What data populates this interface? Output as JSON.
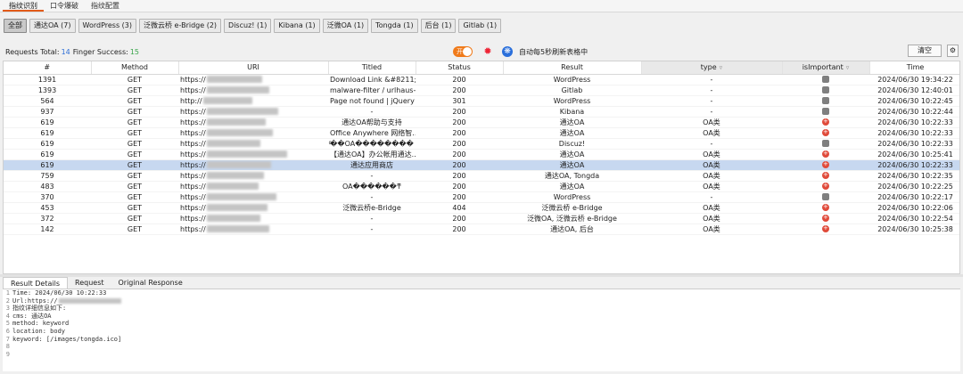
{
  "top_tabs": [
    "指纹识别",
    "口令爆破",
    "指纹配置"
  ],
  "filters": [
    {
      "label": "全部",
      "active": true
    },
    {
      "label": "通达OA (7)"
    },
    {
      "label": "WordPress (3)"
    },
    {
      "label": "泛微云桥 e-Bridge (2)"
    },
    {
      "label": "Discuz! (1)"
    },
    {
      "label": "Kibana (1)"
    },
    {
      "label": "泛微OA (1)"
    },
    {
      "label": "Tongda (1)"
    },
    {
      "label": "后台 (1)"
    },
    {
      "label": "Gitlab (1)"
    }
  ],
  "stats": {
    "requests_label": "Requests Total:",
    "requests_total": "14",
    "finger_label": "Finger Success:",
    "finger_success": "15",
    "toggle_text": "开",
    "auto_refresh_label": "自动每5秒刷新表格中",
    "clear_label": "清空"
  },
  "table": {
    "headers": [
      "#",
      "Method",
      "URI",
      "Titled",
      "Status",
      "Result",
      "type",
      "isImportant",
      "Time"
    ],
    "rows": [
      {
        "id": "1391",
        "method": "GET",
        "uri": "https://",
        "title": "Download Link &#8211; ...",
        "status": "200",
        "result": "WordPress",
        "type": "-",
        "important": "gray",
        "time": "2024/06/30 19:34:22"
      },
      {
        "id": "1393",
        "method": "GET",
        "uri": "https://",
        "title": "malware-filter / urlhaus-fi...",
        "status": "200",
        "result": "Gitlab",
        "type": "-",
        "important": "gray",
        "time": "2024/06/30 12:40:01"
      },
      {
        "id": "564",
        "method": "GET",
        "uri": "http://",
        "title": "Page not found | jQuery F...",
        "status": "301",
        "result": "WordPress",
        "type": "-",
        "important": "gray",
        "time": "2024/06/30 10:22:45"
      },
      {
        "id": "937",
        "method": "GET",
        "uri": "https://",
        "title": "-",
        "status": "200",
        "result": "Kibana",
        "type": "-",
        "important": "gray",
        "time": "2024/06/30 10:22:44"
      },
      {
        "id": "619",
        "method": "GET",
        "uri": "https://",
        "title": "通达OA帮助与支持",
        "status": "200",
        "result": "通达OA",
        "type": "OA类",
        "important": "red",
        "time": "2024/06/30 10:22:33"
      },
      {
        "id": "619",
        "method": "GET",
        "uri": "https://",
        "title": "Office Anywhere 网络智...",
        "status": "200",
        "result": "通达OA",
        "type": "OA类",
        "important": "red",
        "time": "2024/06/30 10:22:33"
      },
      {
        "id": "619",
        "method": "GET",
        "uri": "https://",
        "title": "ͨ��OA��������",
        "status": "200",
        "result": "Discuz!",
        "type": "-",
        "important": "gray",
        "time": "2024/06/30 10:22:33"
      },
      {
        "id": "619",
        "method": "GET",
        "uri": "https://",
        "title": "【通达OA】办公帐用通达...",
        "status": "200",
        "result": "通达OA",
        "type": "OA类",
        "important": "red",
        "time": "2024/06/30 10:25:41"
      },
      {
        "id": "619",
        "method": "GET",
        "uri": "https://",
        "title": "通达应用商店",
        "status": "200",
        "result": "通达OA",
        "type": "OA类",
        "important": "red",
        "time": "2024/06/30 10:22:33",
        "selected": true
      },
      {
        "id": "759",
        "method": "GET",
        "uri": "https://",
        "title": "-",
        "status": "200",
        "result": "通达OA, Tongda",
        "type": "OA类",
        "important": "red",
        "time": "2024/06/30 10:22:35"
      },
      {
        "id": "483",
        "method": "GET",
        "uri": "https://",
        "title": "OA������ͳ",
        "status": "200",
        "result": "通达OA",
        "type": "OA类",
        "important": "red",
        "time": "2024/06/30 10:22:25"
      },
      {
        "id": "370",
        "method": "GET",
        "uri": "https://",
        "title": "-",
        "status": "200",
        "result": "WordPress",
        "type": "-",
        "important": "gray",
        "time": "2024/06/30 10:22:17"
      },
      {
        "id": "453",
        "method": "GET",
        "uri": "https://",
        "title": "泛微云桥e-Bridge",
        "status": "404",
        "result": "泛微云桥 e-Bridge",
        "type": "OA类",
        "important": "red",
        "time": "2024/06/30 10:22:06"
      },
      {
        "id": "372",
        "method": "GET",
        "uri": "https://",
        "title": "-",
        "status": "200",
        "result": "泛微OA, 泛微云桥 e-Bridge",
        "type": "OA类",
        "important": "red",
        "time": "2024/06/30 10:22:54"
      },
      {
        "id": "142",
        "method": "GET",
        "uri": "https://",
        "title": "-",
        "status": "200",
        "result": "通达OA, 后台",
        "type": "OA类",
        "important": "red",
        "time": "2024/06/30 10:25:38"
      }
    ]
  },
  "bottom_tabs": [
    "Result Details",
    "Request",
    "Original Response"
  ],
  "details_lines": [
    "Time: 2024/06/30 10:22:33",
    "Url:https://",
    "指纹详细信息如下:",
    "cms: 通达OA",
    "method: keyword",
    "location: body",
    "keyword: [/images/tongda.ico]",
    "",
    ""
  ],
  "colors": {
    "accent": "#e25b1a",
    "selected_row": "#c7d8f0",
    "important_red": "#e04a3a",
    "blue_count": "#2f6fd6",
    "green_count": "#3aa54b"
  }
}
